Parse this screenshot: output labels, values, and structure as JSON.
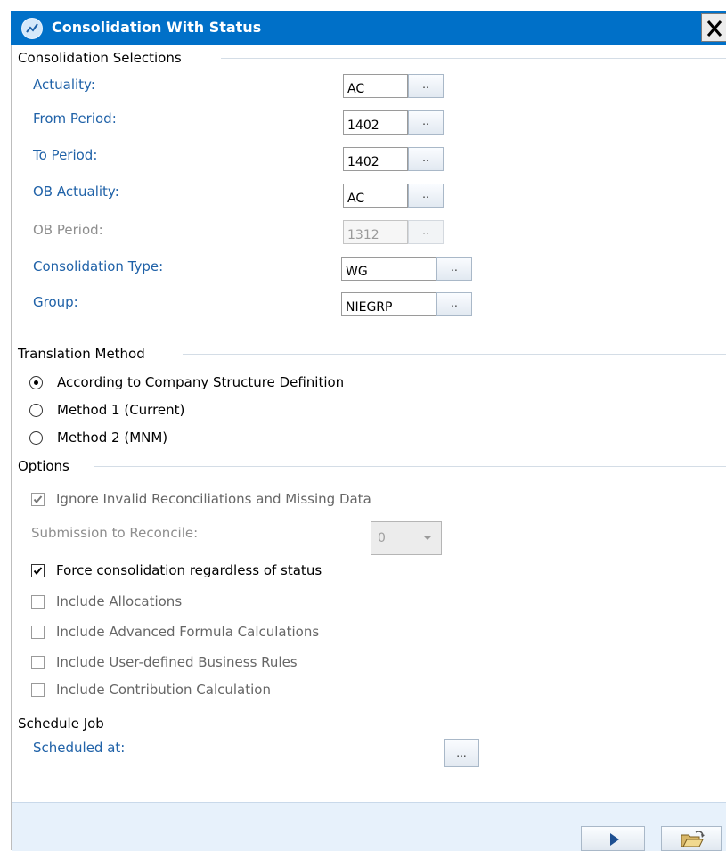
{
  "window": {
    "title": "Consolidation With Status",
    "close_icon": "close-icon",
    "app_icon": "chart-icon"
  },
  "sections": {
    "consolidation": "Consolidation Selections",
    "translation": "Translation Method",
    "options": "Options",
    "schedule": "Schedule Job"
  },
  "fields": {
    "actuality": {
      "label": "Actuality:",
      "value": "AC",
      "button": ".."
    },
    "from_period": {
      "label": "From Period:",
      "value": "1402",
      "button": ".."
    },
    "to_period": {
      "label": "To Period:",
      "value": "1402",
      "button": ".."
    },
    "ob_actuality": {
      "label": "OB Actuality:",
      "value": "AC",
      "button": ".."
    },
    "ob_period": {
      "label": "OB Period:",
      "value": "1312",
      "button": "..",
      "disabled": true
    },
    "consolidation_type": {
      "label": "Consolidation Type:",
      "value": "WG",
      "button": ".."
    },
    "group": {
      "label": "Group:",
      "value": "NIEGRP",
      "button": ".."
    }
  },
  "translation_methods": [
    {
      "label": "According to Company Structure Definition",
      "selected": true
    },
    {
      "label": "Method 1 (Current)",
      "selected": false
    },
    {
      "label": "Method 2 (MNM)",
      "selected": false
    }
  ],
  "options": {
    "ignore_invalid": {
      "label": "Ignore Invalid Reconciliations and Missing Data",
      "checked": true,
      "disabled": true
    },
    "submission_label": "Submission to Reconcile:",
    "submission_value": "0",
    "force": {
      "label": "Force consolidation regardless of status",
      "checked": true
    },
    "allocations": {
      "label": "Include Allocations",
      "checked": false
    },
    "advanced_formula": {
      "label": "Include Advanced Formula Calculations",
      "checked": false
    },
    "user_rules": {
      "label": "Include User-defined Business Rules",
      "checked": false
    },
    "contribution": {
      "label": "Include Contribution Calculation",
      "checked": false
    }
  },
  "schedule": {
    "label": "Scheduled at:",
    "button": "..."
  },
  "footer": {
    "run_icon": "play-icon",
    "open_icon": "open-folder-icon"
  }
}
